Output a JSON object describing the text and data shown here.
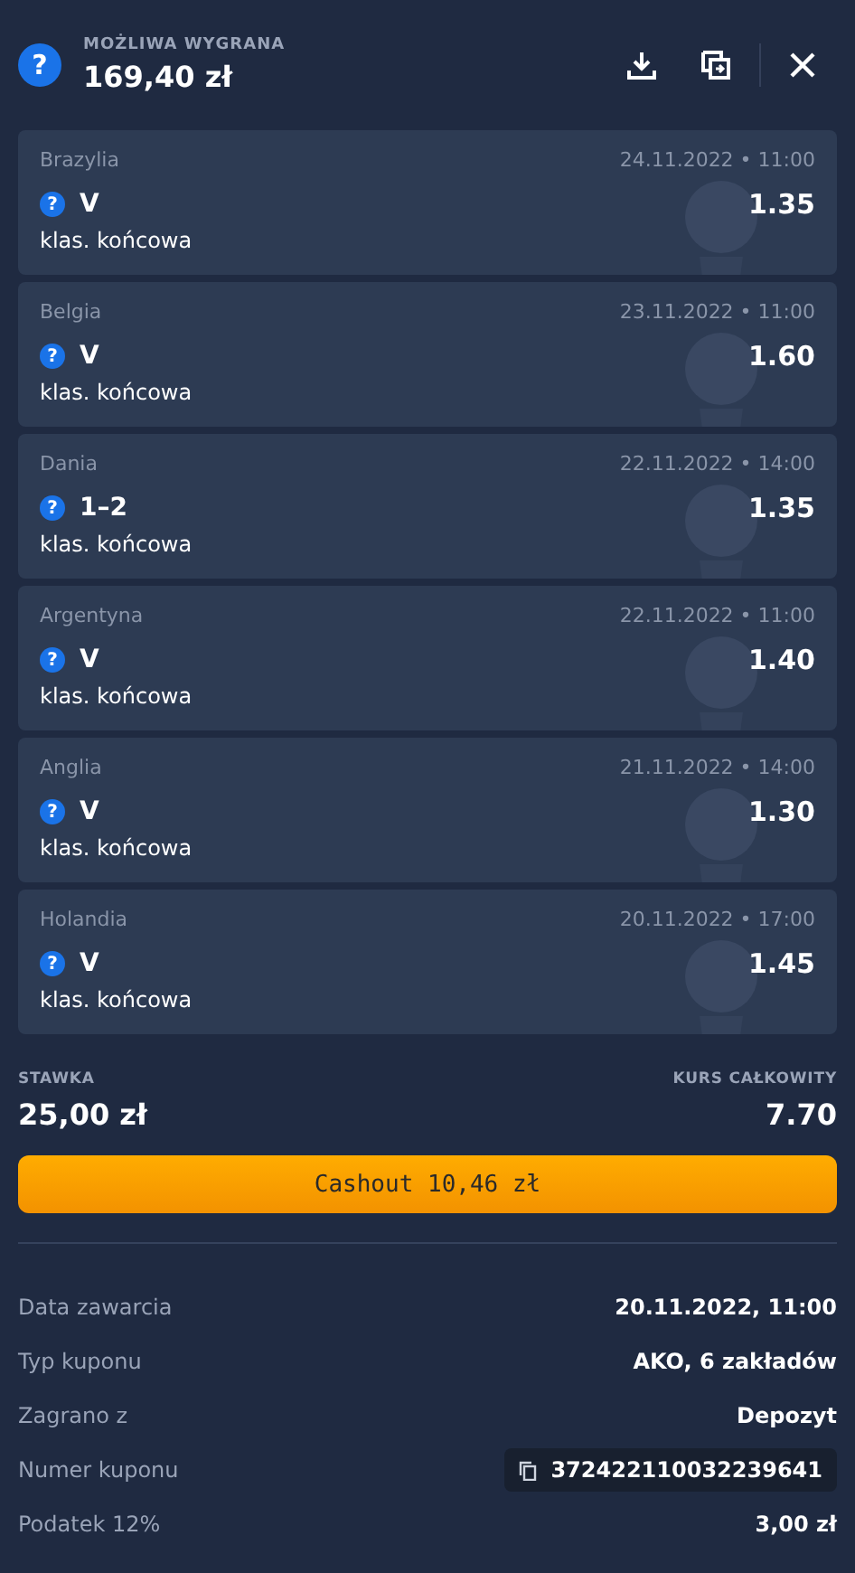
{
  "header": {
    "label": "MOŻLIWA WYGRANA",
    "amount": "169,40 zł",
    "help_icon": "?"
  },
  "bets": [
    {
      "team": "Brazylia",
      "datetime": "24.11.2022 • 11:00",
      "pick": "V",
      "market": "klas. końcowa",
      "odds": "1.35"
    },
    {
      "team": "Belgia",
      "datetime": "23.11.2022 • 11:00",
      "pick": "V",
      "market": "klas. końcowa",
      "odds": "1.60"
    },
    {
      "team": "Dania",
      "datetime": "22.11.2022 • 14:00",
      "pick": "1–2",
      "market": "klas. końcowa",
      "odds": "1.35"
    },
    {
      "team": "Argentyna",
      "datetime": "22.11.2022 • 11:00",
      "pick": "V",
      "market": "klas. końcowa",
      "odds": "1.40"
    },
    {
      "team": "Anglia",
      "datetime": "21.11.2022 • 14:00",
      "pick": "V",
      "market": "klas. końcowa",
      "odds": "1.30"
    },
    {
      "team": "Holandia",
      "datetime": "20.11.2022 • 17:00",
      "pick": "V",
      "market": "klas. końcowa",
      "odds": "1.45"
    }
  ],
  "summary": {
    "stake_label": "STAWKA",
    "stake": "25,00 zł",
    "odds_label": "KURS CAŁKOWITY",
    "total_odds": "7.70"
  },
  "cashout_button": "Cashout 10,46 zł",
  "details": [
    {
      "kind": "plain",
      "label": "Data zawarcia",
      "value": "20.11.2022, 11:00"
    },
    {
      "kind": "plain",
      "label": "Typ kuponu",
      "value": "AKO, 6 zakładów"
    },
    {
      "kind": "plain",
      "label": "Zagrano z",
      "value": "Depozyt"
    },
    {
      "kind": "copy",
      "label": "Numer kuponu",
      "value": "372422110032239641"
    },
    {
      "kind": "plain",
      "label": "Podatek 12%",
      "value": "3,00 zł"
    }
  ]
}
